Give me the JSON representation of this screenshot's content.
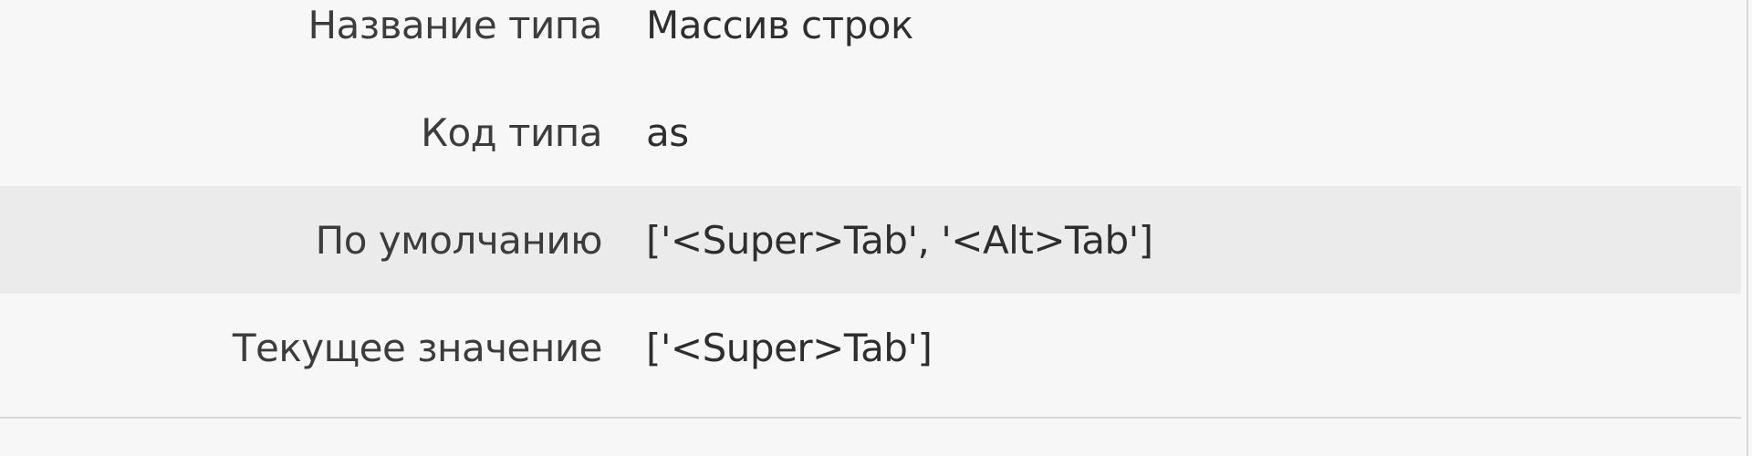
{
  "properties": {
    "rows": [
      {
        "label": "Название типа",
        "value": "Массив строк"
      },
      {
        "label": "Код типа",
        "value": "as"
      },
      {
        "label": "По умолчанию",
        "value": "['<Super>Tab', '<Alt>Tab']"
      },
      {
        "label": "Текущее значение",
        "value": "['<Super>Tab']"
      }
    ]
  }
}
